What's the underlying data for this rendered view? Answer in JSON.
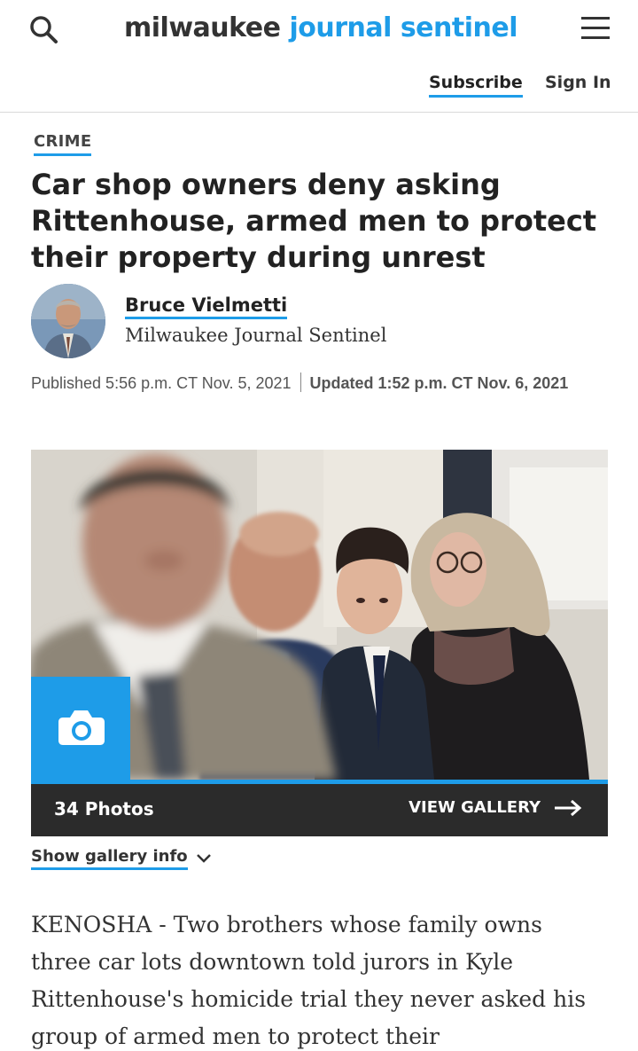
{
  "header": {
    "logo_part1": "milwaukee",
    "logo_part2": "journal sentinel",
    "subscribe_label": "Subscribe",
    "signin_label": "Sign In",
    "accent_color": "#1e9ce8"
  },
  "article": {
    "section": "CRIME",
    "headline": "Car shop owners deny asking Rittenhouse, armed men to protect their property during unrest",
    "author": "Bruce Vielmetti",
    "outlet": "Milwaukee Journal Sentinel",
    "published": "Published 5:56 p.m. CT Nov. 5, 2021",
    "updated": "Updated 1:52 p.m. CT Nov. 6, 2021",
    "body_start": "KENOSHA - Two brothers whose family owns three car lots downtown told jurors in Kyle Rittenhouse's homicide trial they never asked his group of armed men to protect their"
  },
  "gallery": {
    "photo_count": "34 Photos",
    "view_label": "VIEW GALLERY",
    "info_label": "Show gallery info"
  },
  "icons": {
    "search": "search-icon",
    "menu": "menu-icon",
    "camera": "camera-icon",
    "arrow": "arrow-right-icon",
    "chevron": "chevron-down-icon"
  }
}
